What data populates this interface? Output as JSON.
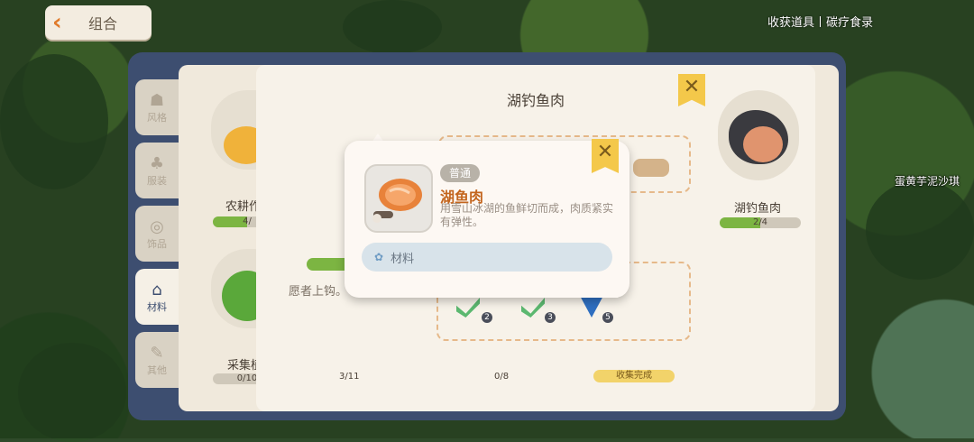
{
  "hud": {
    "back_label": "组合",
    "status_text": "收获道具丨碳疗食录",
    "npc_name": "蛋黄芋泥沙琪"
  },
  "sidebar": {
    "items": [
      {
        "label": "风格",
        "icon": "hanger-icon"
      },
      {
        "label": "服装",
        "icon": "outfit-icon"
      },
      {
        "label": "饰品",
        "icon": "accessory-icon"
      },
      {
        "label": "材料",
        "icon": "hanger-icon"
      },
      {
        "label": "其他",
        "icon": "tool-icon"
      }
    ],
    "active_label": "材料"
  },
  "materials": {
    "cards": [
      {
        "name": "农耕作物",
        "progress": "4/",
        "fill": 0.5
      },
      {
        "name": "采集植物",
        "progress": "0/10",
        "fill": 0.0
      }
    ],
    "hint_text": "愿者上钩。"
  },
  "detail": {
    "title": "湖钓鱼肉",
    "right_card": {
      "name": "湖钓鱼肉",
      "progress": "2/4",
      "fill": 0.5
    },
    "slot_counts": [
      "2",
      "3",
      "5"
    ],
    "bottom_progress": [
      "0/10",
      "3/11",
      "0/8"
    ],
    "collect_status": "收集完成"
  },
  "tooltip": {
    "rarity": "普通",
    "name": "湖鱼肉",
    "description": "用雪山冰湖的鱼鲜切而成，肉质紧实有弹性。",
    "category": "材料"
  },
  "colors": {
    "accent_orange": "#c3651e",
    "progress_green": "#7cb542",
    "panel_navy": "#3d4e70",
    "close_yellow": "#f4c84a"
  }
}
